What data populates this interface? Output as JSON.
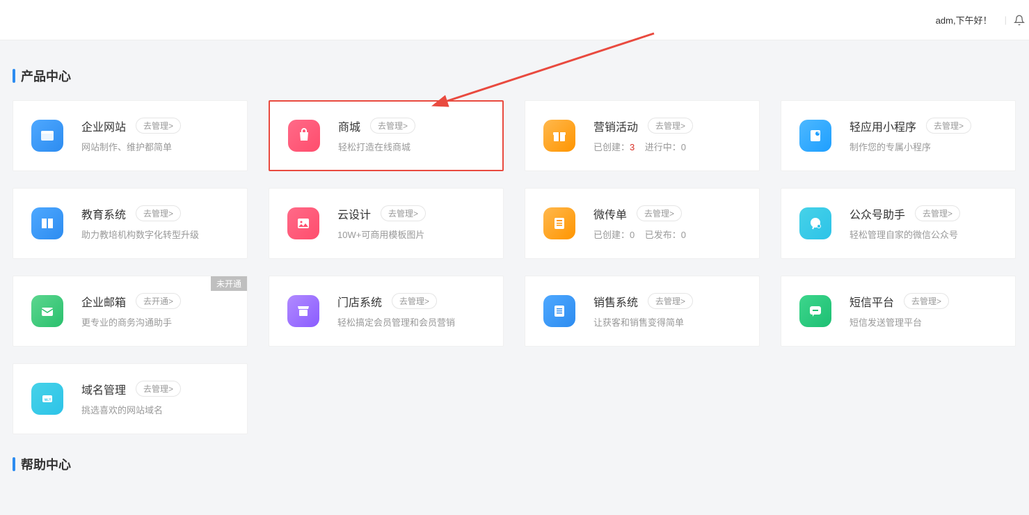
{
  "header": {
    "greeting": "adm,下午好！"
  },
  "section1_title": "产品中心",
  "section2_title": "帮助中心",
  "cards": [
    {
      "title": "企业网站",
      "btn": "去管理>",
      "desc": "网站制作、维护都简单"
    },
    {
      "title": "商城",
      "btn": "去管理>",
      "desc": "轻松打造在线商城"
    },
    {
      "title": "营销活动",
      "btn": "去管理>",
      "desc_label1": "已创建：",
      "desc_val1": "3",
      "desc_label2": "进行中：",
      "desc_val2": "0"
    },
    {
      "title": "轻应用小程序",
      "btn": "去管理>",
      "desc": "制作您的专属小程序"
    },
    {
      "title": "教育系统",
      "btn": "去管理>",
      "desc": "助力教培机构数字化转型升级"
    },
    {
      "title": "云设计",
      "btn": "去管理>",
      "desc": "10W+可商用模板图片"
    },
    {
      "title": "微传单",
      "btn": "去管理>",
      "desc_label1": "已创建：",
      "desc_val1": "0",
      "desc_label2": "已发布：",
      "desc_val2": "0"
    },
    {
      "title": "公众号助手",
      "btn": "去管理>",
      "desc": "轻松管理自家的微信公众号"
    },
    {
      "title": "企业邮箱",
      "btn": "去开通>",
      "desc": "更专业的商务沟通助手",
      "badge": "未开通"
    },
    {
      "title": "门店系统",
      "btn": "去管理>",
      "desc": "轻松搞定会员管理和会员营销"
    },
    {
      "title": "销售系统",
      "btn": "去管理>",
      "desc": "让获客和销售变得简单"
    },
    {
      "title": "短信平台",
      "btn": "去管理>",
      "desc": "短信发送管理平台"
    },
    {
      "title": "域名管理",
      "btn": "去管理>",
      "desc": "挑选喜欢的网站域名"
    }
  ]
}
